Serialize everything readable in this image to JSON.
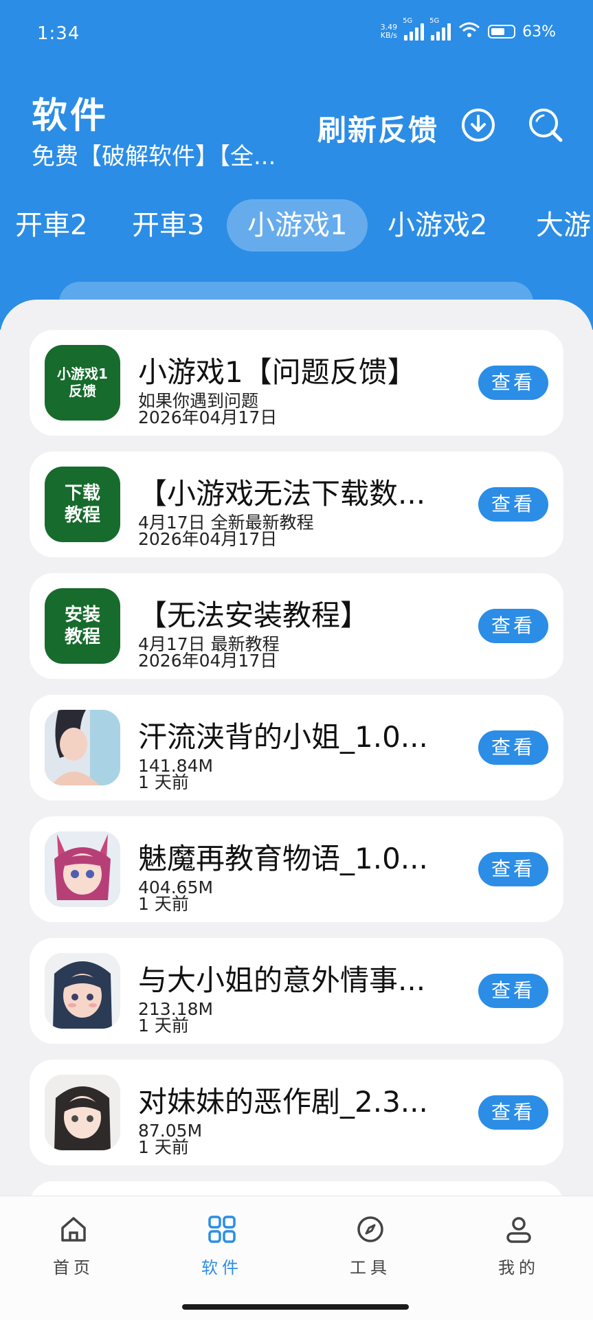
{
  "status_bar": {
    "time": "1:34",
    "net_speed": "3.49",
    "net_unit": "KB/s",
    "sim1": "5G",
    "sim2": "5G",
    "battery": "63%"
  },
  "header": {
    "title": "软件",
    "subtitle": "免费【破解软件】【全...",
    "feedback_label": "刷新反馈",
    "download_icon": "download-icon",
    "search_icon": "search-icon"
  },
  "tabs": [
    {
      "label": "开車2"
    },
    {
      "label": "开車3"
    },
    {
      "label": "小游戏1",
      "active": true
    },
    {
      "label": "小游戏2"
    },
    {
      "label": "大游"
    }
  ],
  "list": [
    {
      "icon_text_1": "小游戏1",
      "icon_text_2": "反馈",
      "title": "小游戏1【问题反馈】",
      "line1": "如果你遇到问题",
      "line2": "2026年04月17日",
      "button": "查看"
    },
    {
      "icon_text_1": "下载",
      "icon_text_2": "教程",
      "title": "【小游戏无法下载数...",
      "line1": "4月17日 全新最新教程",
      "line2": "2026年04月17日",
      "button": "查看"
    },
    {
      "icon_text_1": "安装",
      "icon_text_2": "教程",
      "title": "【无法安装教程】",
      "line1": "4月17日 最新教程",
      "line2": "2026年04月17日",
      "button": "查看"
    },
    {
      "title": "汗流浃背的小姐_1.0...",
      "line1": "141.84M",
      "line2": "1 天前",
      "button": "查看"
    },
    {
      "title": "魅魔再教育物语_1.0...",
      "line1": "404.65M",
      "line2": "1 天前",
      "button": "查看"
    },
    {
      "title": "与大小姐的意外情事...",
      "line1": "213.18M",
      "line2": "1 天前",
      "button": "查看"
    },
    {
      "title": "对妹妹的恶作剧_2.3...",
      "line1": "87.05M",
      "line2": "1 天前",
      "button": "查看"
    }
  ],
  "bottom_nav": [
    {
      "label": "首页",
      "icon": "home-icon"
    },
    {
      "label": "软件",
      "icon": "grid-icon",
      "active": true
    },
    {
      "label": "工具",
      "icon": "compass-icon"
    },
    {
      "label": "我的",
      "icon": "user-icon"
    }
  ],
  "colors": {
    "primary": "#2b8de6",
    "icon_green": "#176b2c",
    "background": "#f1f1f3"
  }
}
